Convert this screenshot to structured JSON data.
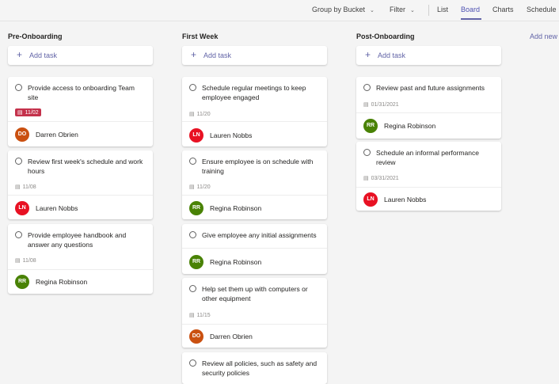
{
  "toolbar": {
    "group_by": "Group by Bucket",
    "filter": "Filter",
    "views": [
      "List",
      "Board",
      "Charts",
      "Schedule"
    ],
    "active_view": "Board"
  },
  "board": {
    "add_new": "Add new bucket",
    "add_task": "Add task",
    "columns": [
      {
        "title": "Pre-Onboarding",
        "tasks": [
          {
            "title": "Provide access to onboarding Team site",
            "due": "11/02",
            "overdue": true,
            "assignee": "Darren Obrien",
            "initials": "DO"
          },
          {
            "title": "Review first week's schedule and work hours",
            "due": "11/08",
            "assignee": "Lauren Nobbs",
            "initials": "LN"
          },
          {
            "title": "Provide employee handbook and answer any questions",
            "due": "11/08",
            "assignee": "Regina Robinson",
            "initials": "RR"
          }
        ]
      },
      {
        "title": "First Week",
        "tasks": [
          {
            "title": "Schedule regular meetings to keep employee engaged",
            "due": "11/20",
            "assignee": "Lauren Nobbs",
            "initials": "LN"
          },
          {
            "title": "Ensure employee is on schedule with training",
            "due": "11/20",
            "assignee": "Regina Robinson",
            "initials": "RR"
          },
          {
            "title": "Give employee any initial assignments",
            "assignee": "Regina Robinson",
            "initials": "RR"
          },
          {
            "title": "Help set them up with computers or other equipment",
            "due": "11/15",
            "assignee": "Darren Obrien",
            "initials": "DO"
          },
          {
            "title": "Review all policies, such as safety and security policies"
          }
        ]
      },
      {
        "title": "Post-Onboarding",
        "tasks": [
          {
            "title": "Review past and future assignments",
            "due": "01/31/2021",
            "assignee": "Regina Robinson",
            "initials": "RR"
          },
          {
            "title": "Schedule an informal performance review",
            "due": "03/31/2021",
            "assignee": "Lauren Nobbs",
            "initials": "LN"
          }
        ]
      }
    ]
  },
  "colors": {
    "accent": "#6264a7",
    "overdue": "#c4314b",
    "avatar_do": "#ca5010",
    "avatar_ln": "#e81123",
    "avatar_rr": "#498205"
  }
}
